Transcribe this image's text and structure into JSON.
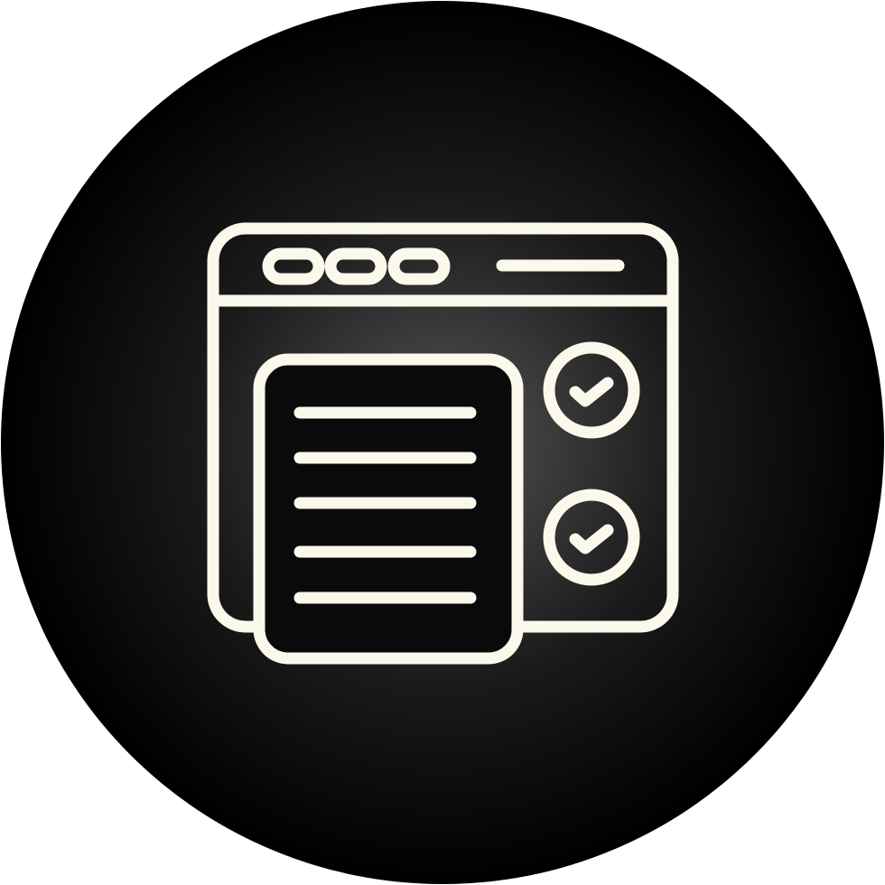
{
  "icon": {
    "name": "browser-checklist-icon",
    "colors": {
      "background_center": "#555555",
      "background_edge": "#000000",
      "stroke": "#fbf8ec"
    },
    "parts": {
      "window_dots": 3,
      "document_lines": 5,
      "check_circles": 2
    }
  }
}
